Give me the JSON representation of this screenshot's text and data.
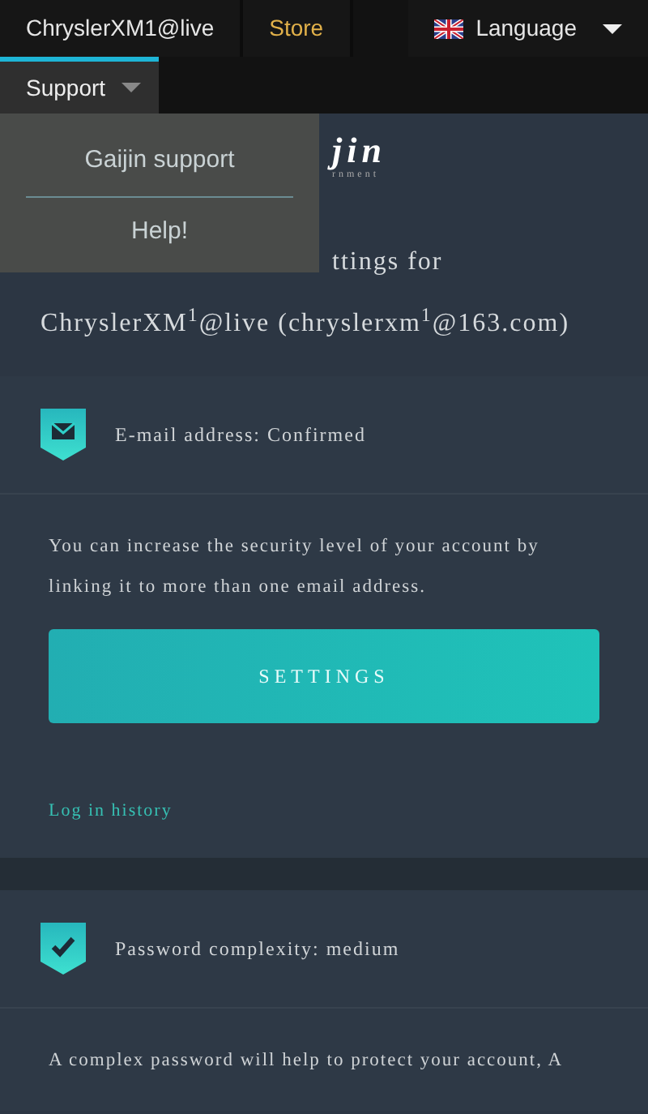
{
  "topbar": {
    "user": "ChryslerXM1@live",
    "store": "Store",
    "language": "Language"
  },
  "menu": {
    "label": "Support",
    "expanded": true,
    "items": [
      "Gaijin support",
      "Help!"
    ]
  },
  "logo": {
    "visible_text": "jin",
    "subtitle": "rnment"
  },
  "heading": {
    "line_1": "ttings for",
    "line_2": "ChryslerXM$^{1}$@live (chryslerxm$^{1}$@163.com)"
  },
  "sections": [
    {
      "kind": "email",
      "title": "E-mail address: Confirmed",
      "text": "You can increase the security level of your account by linking it to more than one email address.",
      "button": "SETTINGS",
      "link": "Log in history"
    },
    {
      "kind": "password",
      "title": "Password complexity: medium",
      "text": "A complex password will help to protect your account, A"
    }
  ]
}
